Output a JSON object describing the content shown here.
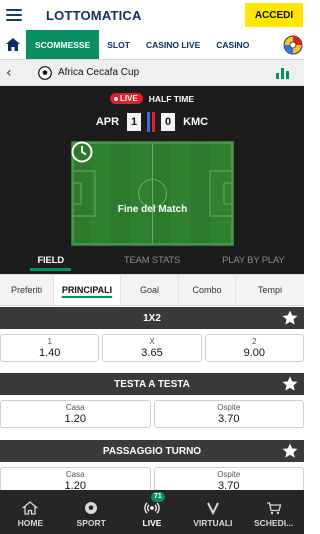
{
  "header": {
    "logo": "LOTTOMATICA",
    "login_label": "ACCEDI"
  },
  "nav": {
    "tabs": [
      "SCOMMESSE",
      "SLOT",
      "CASINO LIVE",
      "CASINO"
    ]
  },
  "competition": {
    "name": "Africa Cecafa Cup"
  },
  "match": {
    "live_label": "LIVE",
    "status": "HALF TIME",
    "home_team": "APR",
    "away_team": "KMC",
    "home_score": "1",
    "away_score": "0",
    "pitch_text": "Fine del Match",
    "tabs": [
      "FIELD",
      "TEAM STATS",
      "PLAY BY PLAY"
    ]
  },
  "market_tabs": [
    "Preferiti",
    "PRINCIPALI",
    "Goal",
    "Combo",
    "Tempi"
  ],
  "markets": [
    {
      "title": "1X2",
      "odds": [
        {
          "label": "1",
          "value": "1.40"
        },
        {
          "label": "X",
          "value": "3.65"
        },
        {
          "label": "2",
          "value": "9.00"
        }
      ]
    },
    {
      "title": "TESTA A TESTA",
      "odds": [
        {
          "label": "Casa",
          "value": "1.20"
        },
        {
          "label": "Ospite",
          "value": "3.70"
        }
      ]
    },
    {
      "title": "PASSAGGIO TURNO",
      "odds": [
        {
          "label": "Casa",
          "value": "1.20"
        },
        {
          "label": "Ospite",
          "value": "3.70"
        }
      ]
    }
  ],
  "bottom_nav": [
    {
      "label": "HOME",
      "icon": "home-icon"
    },
    {
      "label": "SPORT",
      "icon": "soccer-ball-icon"
    },
    {
      "label": "LIVE",
      "icon": "live-signal-icon",
      "badge": "71"
    },
    {
      "label": "VIRTUALI",
      "icon": "virtual-v-icon"
    },
    {
      "label": "SCHEDI...",
      "icon": "cart-icon"
    }
  ],
  "colors": {
    "brand_green": "#0a8f63",
    "live_red": "#e0202c",
    "accedi_yellow": "#ffe600",
    "navy": "#0b2c6b"
  }
}
